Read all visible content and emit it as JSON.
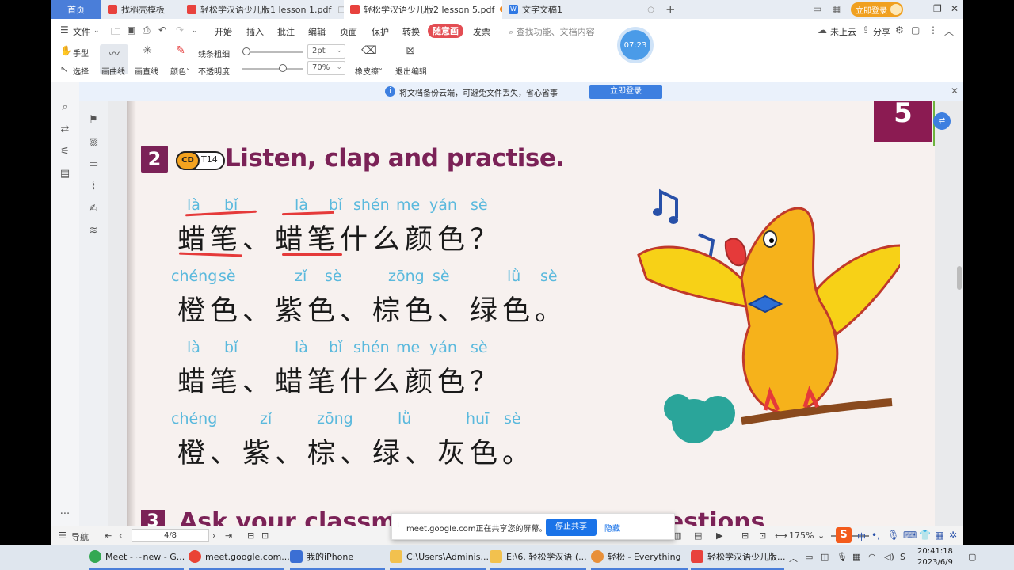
{
  "tabs": [
    {
      "label": "首页",
      "kind": "home"
    },
    {
      "label": "找稻壳模板",
      "icon_color": "#e8423d"
    },
    {
      "label": "轻松学汉语少儿版1 lesson 1.pdf",
      "icon_color": "#e8423d"
    },
    {
      "label": "轻松学汉语少儿版2 lesson 5.pdf",
      "icon_color": "#e8423d",
      "active": true
    },
    {
      "label": "文字文稿1",
      "icon_color": "#2f78e4",
      "icon_text": "W"
    }
  ],
  "header": {
    "login_label": "立即登录",
    "timer": "07:23"
  },
  "menu": {
    "file": "文件",
    "items": [
      "开始",
      "插入",
      "批注",
      "编辑",
      "页面",
      "保护",
      "转换"
    ],
    "highlighted": "随意画",
    "after": "发票",
    "search_placeholder": "查找功能、文档内容",
    "cloud": "未上云",
    "share": "分享"
  },
  "toolbar": {
    "hand": "手型",
    "select": "选择",
    "curve": "画曲线",
    "line": "画直线",
    "color": "颜色",
    "thickness_label": "线条粗细",
    "thickness_value": "2pt",
    "opacity_label": "不透明度",
    "opacity_value": "70%",
    "opacity_level": 0.7,
    "eraser": "橡皮擦",
    "exit_edit": "退出编辑"
  },
  "notice": {
    "text": "将文档备份云端，可避免文件丢失，省心省事",
    "button": "立即登录"
  },
  "page": {
    "page_number": "5",
    "section_number": "2",
    "cd_label": "CD",
    "track": "T14",
    "section_title": "Listen, clap and practise.",
    "rows": [
      {
        "pinyin": [
          "là",
          "bǐ",
          "là",
          "bǐ",
          "shén",
          "me",
          "yán",
          "sè"
        ],
        "hanzi": "蜡笔、蜡笔什么颜色？"
      },
      {
        "pinyin": [
          "chéng",
          "sè",
          "zǐ",
          "sè",
          "zōng",
          "sè",
          "lǜ",
          "sè"
        ],
        "hanzi": "橙色、紫色、棕色、绿色。"
      },
      {
        "pinyin": [
          "là",
          "bǐ",
          "là",
          "bǐ",
          "shén",
          "me",
          "yán",
          "sè"
        ],
        "hanzi": "蜡笔、蜡笔什么颜色？"
      },
      {
        "pinyin": [
          "chéng",
          "zǐ",
          "zōng",
          "lǜ",
          "huī",
          "sè"
        ],
        "hanzi": "橙、紫、棕、绿、灰色。"
      }
    ],
    "next_section_number": "3",
    "next_section_title_left": "Ask your classm",
    "next_section_title_right": "questions"
  },
  "share_popup": {
    "text": "meet.google.com正在共享您的屏幕。",
    "stop": "停止共享",
    "hide": "隐藏"
  },
  "statusbar": {
    "nav": "导航",
    "page": "4/8",
    "zoom": "175%"
  },
  "taskbar": {
    "items": [
      {
        "label": "Meet - ~new - G...",
        "icon_color": "#34a853"
      },
      {
        "label": "meet.google.com...",
        "icon_color": "#ea4335"
      },
      {
        "label": "我的iPhone",
        "icon_color": "#3b6fd4"
      },
      {
        "label": "C:\\Users\\Adminis...",
        "icon_color": "#f2c14e"
      },
      {
        "label": "E:\\6. 轻松学汉语 (...",
        "icon_color": "#f2c14e"
      },
      {
        "label": "轻松 - Everything",
        "icon_color": "#e8903a"
      },
      {
        "label": "轻松学汉语少儿版...",
        "icon_color": "#e8423d"
      }
    ],
    "time": "20:41:18",
    "date": "2023/6/9",
    "ime": "中"
  }
}
